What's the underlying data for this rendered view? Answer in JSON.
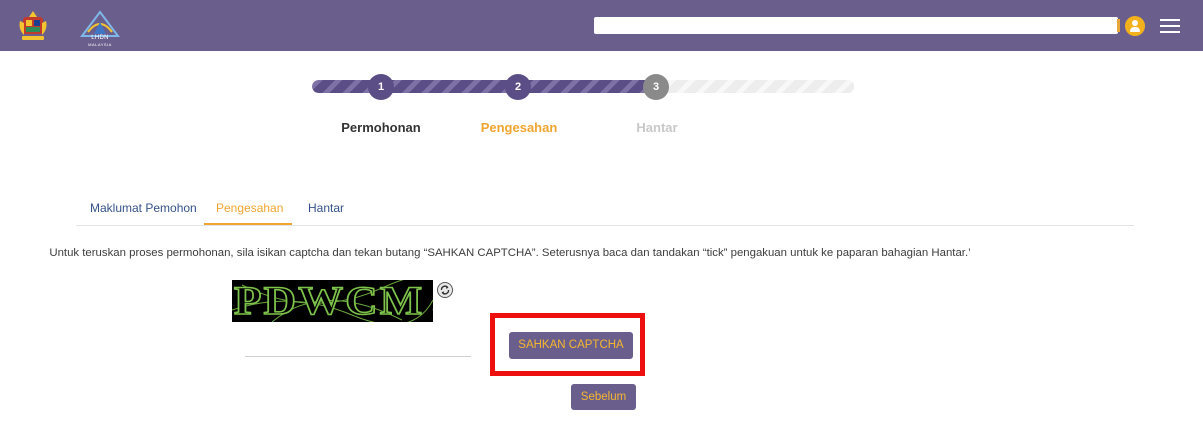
{
  "header": {
    "logo_crest_icon": "malaysia-crest-icon",
    "logo_lhdn": {
      "text": "LHDN",
      "subtext": "MALAYSIA"
    },
    "search": {
      "value": "",
      "placeholder": ""
    },
    "user_icon": "user-avatar-icon",
    "menu_icon": "hamburger-menu-icon"
  },
  "progress": {
    "fraction": 0.64,
    "steps": [
      {
        "number": "1",
        "label": "Permohonan",
        "status": "done",
        "label_color": "#333333"
      },
      {
        "number": "2",
        "label": "Pengesahan",
        "status": "current",
        "label_color": "#f0a530"
      },
      {
        "number": "3",
        "label": "Hantar",
        "status": "pending",
        "label_color": "#c8c8c8"
      }
    ]
  },
  "tabs": [
    {
      "label": "Maklumat Pemohon",
      "active": false
    },
    {
      "label": "Pengesahan",
      "active": true
    },
    {
      "label": "Hantar",
      "active": false
    }
  ],
  "instruction": "Untuk teruskan proses permohonan, sila isikan captcha dan tekan butang “SAHKAN CAPTCHA”. Seterusnya baca dan tandakan “tick” pengakuan untuk ke paparan bahagian Hantar.’",
  "captcha": {
    "text": "PDWCM",
    "refresh_icon": "refresh-icon",
    "input_value": "",
    "input_placeholder": ""
  },
  "buttons": {
    "sahkan_label": "SAHKAN CAPTCHA",
    "sebelum_label": "Sebelum"
  },
  "colors": {
    "brand": "#6a5e8c",
    "accent": "#f0a530",
    "highlight": "#ee0f0f",
    "link": "#35528a"
  }
}
